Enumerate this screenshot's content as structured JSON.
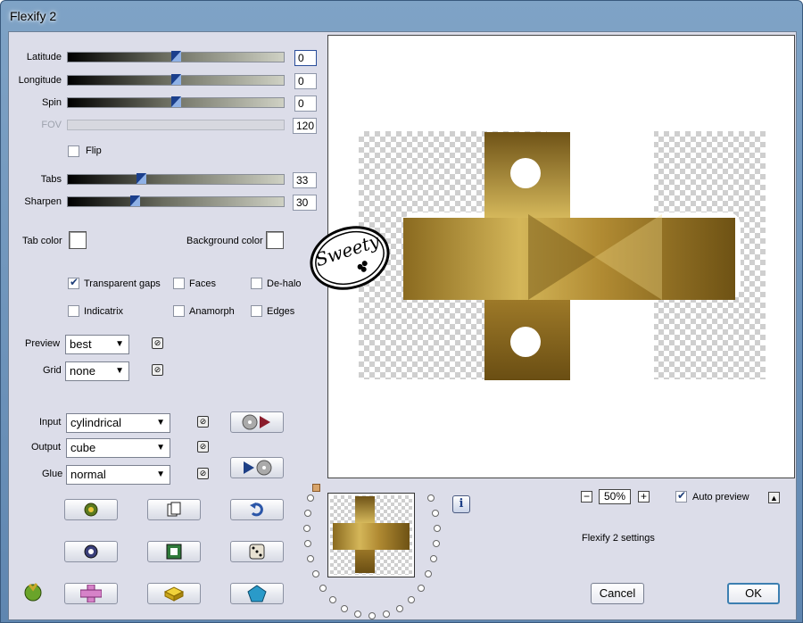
{
  "window": {
    "title": "Flexify 2"
  },
  "sliders": {
    "latitude": {
      "label": "Latitude",
      "value": "0",
      "level": 0.5
    },
    "longitude": {
      "label": "Longitude",
      "value": "0",
      "level": 0.5
    },
    "spin": {
      "label": "Spin",
      "value": "0",
      "level": 0.5
    },
    "fov": {
      "label": "FOV",
      "value": "120",
      "level": 0
    },
    "tabs": {
      "label": "Tabs",
      "value": "33",
      "level": 0.33
    },
    "sharpen": {
      "label": "Sharpen",
      "value": "30",
      "level": 0.3
    }
  },
  "flip": {
    "label": "Flip",
    "checked": false
  },
  "colors": {
    "tab_color_label": "Tab color",
    "background_color_label": "Background color"
  },
  "options": {
    "transparent_gaps": {
      "label": "Transparent gaps",
      "checked": true
    },
    "faces": {
      "label": "Faces",
      "checked": false
    },
    "de_halo": {
      "label": "De-halo",
      "checked": false
    },
    "indicatrix": {
      "label": "Indicatrix",
      "checked": false
    },
    "anamorph": {
      "label": "Anamorph",
      "checked": false
    },
    "edges": {
      "label": "Edges",
      "checked": false
    }
  },
  "preview_select": {
    "label": "Preview",
    "value": "best"
  },
  "grid_select": {
    "label": "Grid",
    "value": "none"
  },
  "input_select": {
    "label": "Input",
    "value": "cylindrical"
  },
  "output_select": {
    "label": "Output",
    "value": "cube"
  },
  "glue_select": {
    "label": "Glue",
    "value": "normal"
  },
  "zoom": {
    "value": "50%"
  },
  "auto_preview": {
    "label": "Auto preview",
    "checked": true
  },
  "settings_label": "Flexify 2 settings",
  "buttons": {
    "cancel": "Cancel",
    "ok": "OK"
  },
  "icons": {
    "link": "link-icon",
    "info": "info-icon"
  },
  "watermark_text": "Sweety"
}
